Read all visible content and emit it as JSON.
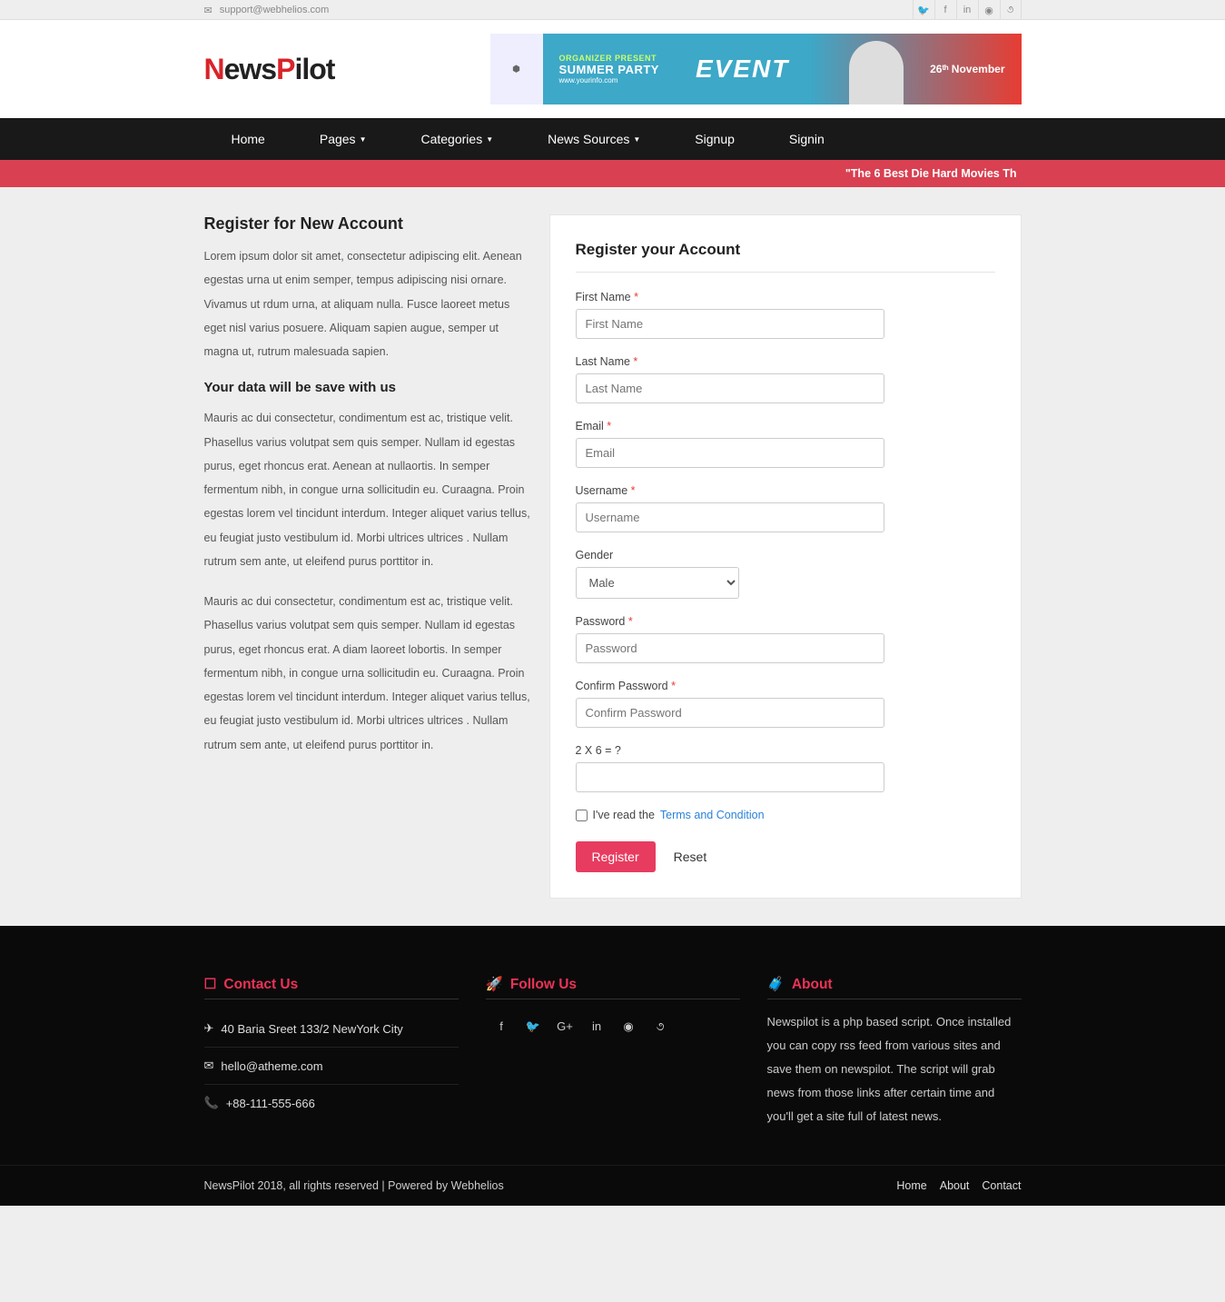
{
  "topbar": {
    "email": "support@webhelios.com"
  },
  "logo": {
    "part1": "N",
    "part2": "ews",
    "part3": "P",
    "part4": "ilot"
  },
  "banner": {
    "line1": "ORGANIZER PRESENT",
    "line2": "SUMMER PARTY",
    "line3": "www.yourinfo.com",
    "event": "EVENT",
    "date": "26ᵗʰ November"
  },
  "nav": {
    "home": "Home",
    "pages": "Pages",
    "categories": "Categories",
    "news_sources": "News Sources",
    "signup": "Signup",
    "signin": "Signin"
  },
  "ticker": {
    "text": "\"The 6 Best Die Hard Movies Th"
  },
  "left": {
    "h2": "Register for New Account",
    "p1": "Lorem ipsum dolor sit amet, consectetur adipiscing elit. Aenean egestas urna ut enim semper, tempus adipiscing nisi ornare. Vivamus ut rdum urna, at aliquam nulla. Fusce laoreet metus eget nisl varius posuere. Aliquam sapien augue, semper ut magna ut, rutrum malesuada sapien.",
    "h3": "Your data will be save with us",
    "p2": "Mauris ac dui consectetur, condimentum est ac, tristique velit. Phasellus varius volutpat sem quis semper. Nullam id egestas purus, eget rhoncus erat. Aenean at nullaortis. In semper fermentum nibh, in congue urna sollicitudin eu. Curaagna. Proin egestas lorem vel tincidunt interdum. Integer aliquet varius tellus, eu feugiat justo vestibulum id. Morbi ultrices ultrices . Nullam rutrum sem ante, ut eleifend purus porttitor in.",
    "p3": "Mauris ac dui consectetur, condimentum est ac, tristique velit. Phasellus varius volutpat sem quis semper. Nullam id egestas purus, eget rhoncus erat. A diam laoreet lobortis. In semper fermentum nibh, in congue urna sollicitudin eu. Curaagna. Proin egestas lorem vel tincidunt interdum. Integer aliquet varius tellus, eu feugiat justo vestibulum id. Morbi ultrices ultrices . Nullam rutrum sem ante, ut eleifend purus porttitor in."
  },
  "form": {
    "heading": "Register your Account",
    "first_name": {
      "label": "First Name ",
      "placeholder": "First Name"
    },
    "last_name": {
      "label": "Last Name ",
      "placeholder": "Last Name"
    },
    "email": {
      "label": "Email ",
      "placeholder": "Email"
    },
    "username": {
      "label": "Username ",
      "placeholder": "Username"
    },
    "gender": {
      "label": "Gender",
      "value": "Male"
    },
    "password": {
      "label": "Password ",
      "placeholder": "Password"
    },
    "confirm": {
      "label": "Confirm Password ",
      "placeholder": "Confirm Password"
    },
    "captcha": {
      "label": "2 X 6 = ?"
    },
    "terms_text": "I've read the ",
    "terms_link": "Terms and Condition",
    "register": "Register",
    "reset": "Reset",
    "req": "*"
  },
  "footer": {
    "contact": {
      "title": "Contact Us",
      "address": "40 Baria Sreet 133/2 NewYork City",
      "email": "hello@atheme.com",
      "phone": "+88-111-555-666"
    },
    "follow": {
      "title": "Follow Us"
    },
    "about": {
      "title": "About",
      "text": "Newspilot is a php based script. Once installed you can copy rss feed from various sites and save them on newspilot. The script will grab news from those links after certain time and you'll get a site full of latest news."
    }
  },
  "bottom": {
    "copyright": "NewsPilot 2018, all rights reserved | Powered by Webhelios",
    "home": "Home",
    "about": "About",
    "contact": "Contact"
  }
}
